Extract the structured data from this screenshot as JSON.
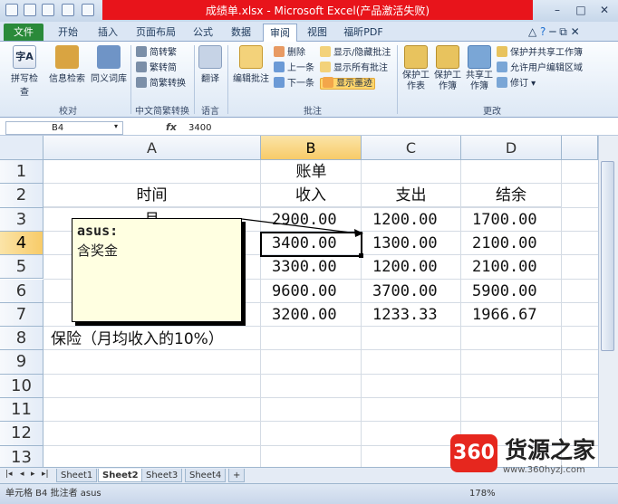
{
  "window": {
    "title": "成绩单.xlsx - Microsoft Excel(产品激活失败)",
    "controls": {
      "minimize": "–",
      "maximize": "□",
      "close": "✕"
    }
  },
  "ribbon_tabs": [
    "文件",
    "开始",
    "插入",
    "页面布局",
    "公式",
    "数据",
    "审阅",
    "视图",
    "福昕PDF"
  ],
  "ribbon": {
    "proofing": {
      "spell": "拼写检查",
      "research": "信息检索",
      "thesaurus": "同义词库",
      "label": "校对"
    },
    "chinese": {
      "to_trad": "简转繁",
      "to_simp": "繁转简",
      "convert": "简繁转换",
      "label": "中文简繁转换"
    },
    "language": {
      "translate": "翻译",
      "label": "语言"
    },
    "comments": {
      "edit": "编辑批注",
      "delete": "删除",
      "prev": "上一条",
      "next": "下一条",
      "show_hide": "显示/隐藏批注",
      "show_all": "显示所有批注",
      "show_ink": "显示墨迹",
      "label": "批注"
    },
    "changes": {
      "protect_sheet": "保护工作表",
      "protect_book": "保护工作簿",
      "share_book": "共享工作簿",
      "protect_share": "保护并共享工作簿",
      "allow_edit": "允许用户编辑区域",
      "track": "修订",
      "label": "更改"
    }
  },
  "formula_bar": {
    "name_box": "B4",
    "fx": "fx",
    "value": "3400"
  },
  "columns": [
    "A",
    "B",
    "C",
    "D"
  ],
  "rows": [
    "1",
    "2",
    "3",
    "4",
    "5",
    "6",
    "7",
    "8",
    "9",
    "10",
    "11",
    "12",
    "13"
  ],
  "cells": {
    "title": "账单",
    "headers": [
      "时间",
      "收入",
      "支出",
      "结余"
    ],
    "a3_partial": "月",
    "data": [
      [
        "2900.00",
        "1200.00",
        "1700.00"
      ],
      [
        "3400.00",
        "1300.00",
        "2100.00"
      ],
      [
        "3300.00",
        "1200.00",
        "2100.00"
      ],
      [
        "9600.00",
        "3700.00",
        "5900.00"
      ],
      [
        "3200.00",
        "1233.33",
        "1966.67"
      ]
    ],
    "a8": "保险（月均收入的10%）"
  },
  "comment": {
    "author": "asus:",
    "text": "含奖金"
  },
  "sheets": [
    "Sheet1",
    "Sheet2",
    "Sheet3",
    "Sheet4"
  ],
  "status": {
    "text": "单元格 B4 批注者 asus",
    "zoom": "178%"
  },
  "watermark": {
    "badge": "360",
    "name": "货源之家",
    "url": "www.360hyzj.com"
  }
}
